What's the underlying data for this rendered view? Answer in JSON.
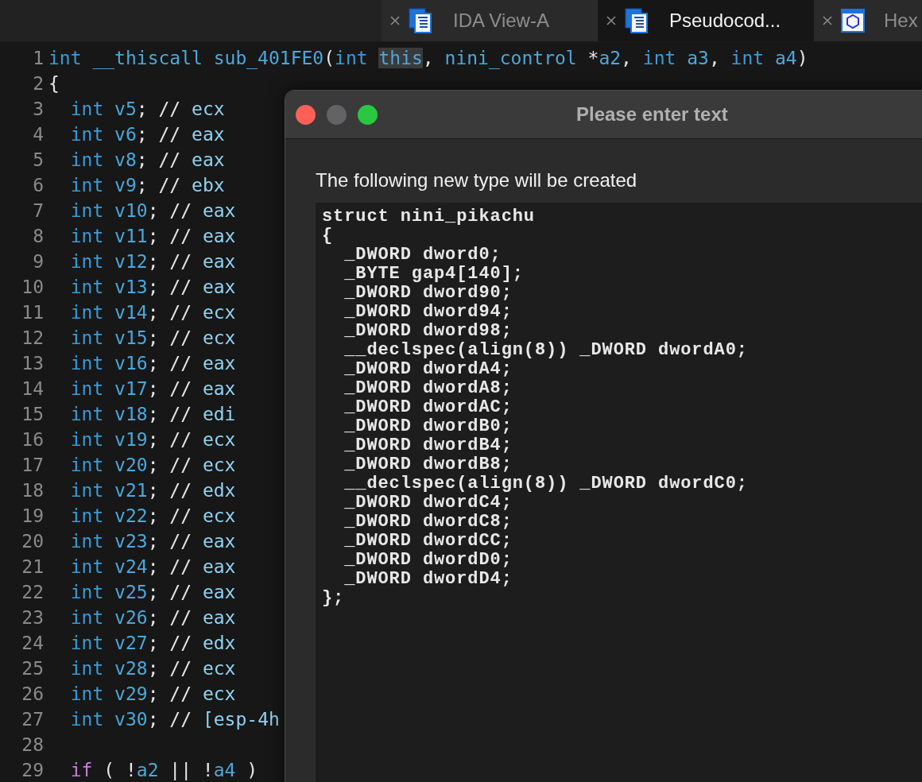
{
  "tabs": [
    {
      "label": "IDA View-A",
      "selected": false
    },
    {
      "label": "Pseudocod...",
      "selected": true
    },
    {
      "label": "Hex",
      "selected": false
    }
  ],
  "code_lines": [
    {
      "number": "1",
      "kind": "tokens",
      "tokens": [
        {
          "kind": "type",
          "text": "int "
        },
        {
          "kind": "name",
          "text": "__thiscall sub_401FE0"
        },
        {
          "kind": "plain",
          "text": "("
        },
        {
          "kind": "type",
          "text": "int "
        },
        {
          "kind": "selected",
          "text": "this"
        },
        {
          "kind": "plain",
          "text": ", "
        },
        {
          "kind": "name",
          "text": "nini_control"
        },
        {
          "kind": "plain",
          "text": " *"
        },
        {
          "kind": "name",
          "text": "a2"
        },
        {
          "kind": "plain",
          "text": ", "
        },
        {
          "kind": "type",
          "text": "int "
        },
        {
          "kind": "name",
          "text": "a3"
        },
        {
          "kind": "plain",
          "text": ", "
        },
        {
          "kind": "type",
          "text": "int "
        },
        {
          "kind": "name",
          "text": "a4"
        },
        {
          "kind": "plain",
          "text": ")"
        }
      ]
    },
    {
      "number": "2",
      "kind": "tokens",
      "tokens": [
        {
          "kind": "plain",
          "text": "{"
        }
      ]
    },
    {
      "number": "3",
      "kind": "declaration",
      "type": "int",
      "name": "v5",
      "separator": "; //",
      "comment": "ecx"
    },
    {
      "number": "4",
      "kind": "declaration",
      "type": "int",
      "name": "v6",
      "separator": "; //",
      "comment": "eax"
    },
    {
      "number": "5",
      "kind": "declaration",
      "type": "int",
      "name": "v8",
      "separator": "; //",
      "comment": "eax"
    },
    {
      "number": "6",
      "kind": "declaration",
      "type": "int",
      "name": "v9",
      "separator": "; //",
      "comment": "ebx"
    },
    {
      "number": "7",
      "kind": "declaration",
      "type": "int",
      "name": "v10",
      "separator": "; //",
      "comment": "eax"
    },
    {
      "number": "8",
      "kind": "declaration",
      "type": "int",
      "name": "v11",
      "separator": "; //",
      "comment": "eax"
    },
    {
      "number": "9",
      "kind": "declaration",
      "type": "int",
      "name": "v12",
      "separator": "; //",
      "comment": "eax"
    },
    {
      "number": "10",
      "kind": "declaration",
      "type": "int",
      "name": "v13",
      "separator": "; //",
      "comment": "eax"
    },
    {
      "number": "11",
      "kind": "declaration",
      "type": "int",
      "name": "v14",
      "separator": "; //",
      "comment": "ecx"
    },
    {
      "number": "12",
      "kind": "declaration",
      "type": "int",
      "name": "v15",
      "separator": "; //",
      "comment": "ecx"
    },
    {
      "number": "13",
      "kind": "declaration",
      "type": "int",
      "name": "v16",
      "separator": "; //",
      "comment": "eax"
    },
    {
      "number": "14",
      "kind": "declaration",
      "type": "int",
      "name": "v17",
      "separator": "; //",
      "comment": "eax"
    },
    {
      "number": "15",
      "kind": "declaration",
      "type": "int",
      "name": "v18",
      "separator": "; //",
      "comment": "edi"
    },
    {
      "number": "16",
      "kind": "declaration",
      "type": "int",
      "name": "v19",
      "separator": "; //",
      "comment": "ecx"
    },
    {
      "number": "17",
      "kind": "declaration",
      "type": "int",
      "name": "v20",
      "separator": "; //",
      "comment": "ecx"
    },
    {
      "number": "18",
      "kind": "declaration",
      "type": "int",
      "name": "v21",
      "separator": "; //",
      "comment": "edx"
    },
    {
      "number": "19",
      "kind": "declaration",
      "type": "int",
      "name": "v22",
      "separator": "; //",
      "comment": "ecx"
    },
    {
      "number": "20",
      "kind": "declaration",
      "type": "int",
      "name": "v23",
      "separator": "; //",
      "comment": "eax"
    },
    {
      "number": "21",
      "kind": "declaration",
      "type": "int",
      "name": "v24",
      "separator": "; //",
      "comment": "eax"
    },
    {
      "number": "22",
      "kind": "declaration",
      "type": "int",
      "name": "v25",
      "separator": "; //",
      "comment": "eax"
    },
    {
      "number": "23",
      "kind": "declaration",
      "type": "int",
      "name": "v26",
      "separator": "; //",
      "comment": "eax"
    },
    {
      "number": "24",
      "kind": "declaration",
      "type": "int",
      "name": "v27",
      "separator": "; //",
      "comment": "edx"
    },
    {
      "number": "25",
      "kind": "declaration",
      "type": "int",
      "name": "v28",
      "separator": "; //",
      "comment": "ecx"
    },
    {
      "number": "26",
      "kind": "declaration",
      "type": "int",
      "name": "v29",
      "separator": "; //",
      "comment": "ecx"
    },
    {
      "number": "27",
      "kind": "declaration",
      "type": "int",
      "name": "v30",
      "separator": "; //",
      "comment": "[esp-4h"
    },
    {
      "number": "28",
      "kind": "blank"
    },
    {
      "number": "29",
      "kind": "tokens",
      "tokens": [
        {
          "kind": "keyword",
          "text": "  if"
        },
        {
          "kind": "plain",
          "text": " ( !"
        },
        {
          "kind": "name",
          "text": "a2"
        },
        {
          "kind": "plain",
          "text": " || !"
        },
        {
          "kind": "name",
          "text": "a4"
        },
        {
          "kind": "plain",
          "text": " )"
        }
      ]
    }
  ],
  "dialog": {
    "title": "Please enter text",
    "message": "The following new type will be created",
    "text_lines": [
      "struct nini_pikachu",
      "{",
      "  _DWORD dword0;",
      "  _BYTE gap4[140];",
      "  _DWORD dword90;",
      "  _DWORD dword94;",
      "  _DWORD dword98;",
      "  __declspec(align(8)) _DWORD dwordA0;",
      "  _DWORD dwordA4;",
      "  _DWORD dwordA8;",
      "  _DWORD dwordAC;",
      "  _DWORD dwordB0;",
      "  _DWORD dwordB4;",
      "  _DWORD dwordB8;",
      "  __declspec(align(8)) _DWORD dwordC0;",
      "  _DWORD dwordC4;",
      "  _DWORD dwordC8;",
      "  _DWORD dwordCC;",
      "  _DWORD dwordD0;",
      "  _DWORD dwordD4;",
      "};"
    ]
  }
}
